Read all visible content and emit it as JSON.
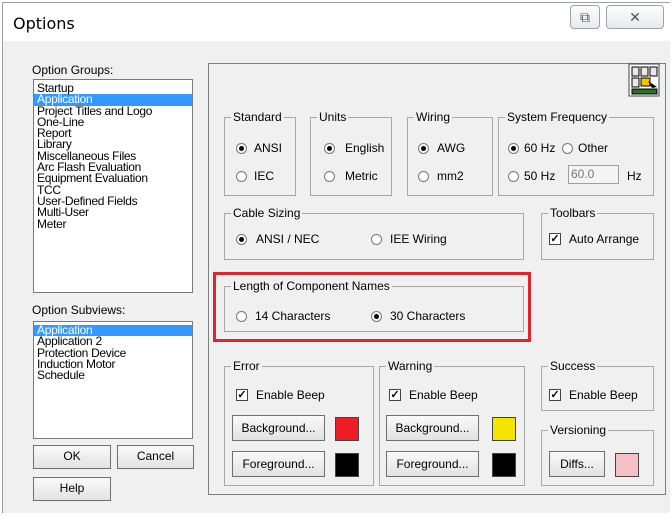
{
  "window": {
    "title": "Options",
    "minimize_glyph": "⧉",
    "close_glyph": "✕"
  },
  "option_groups": {
    "label": "Option Groups:",
    "items": [
      "Startup",
      "Application",
      "Project Titles and Logo",
      "One-Line",
      "Report",
      "Library",
      "Miscellaneous Files",
      "Arc Flash Evaluation",
      "Equipment Evaluation",
      "TCC",
      "User-Defined Fields",
      "Multi-User",
      "Meter"
    ],
    "selected": "Application"
  },
  "option_subviews": {
    "label": "Option Subviews:",
    "items": [
      "Application",
      "Application 2",
      "Protection Device",
      "Induction Motor",
      "Schedule"
    ],
    "selected": "Application"
  },
  "buttons": {
    "ok": "OK",
    "cancel": "Cancel",
    "help": "Help"
  },
  "standard": {
    "title": "Standard",
    "ansi": "ANSI",
    "iec": "IEC",
    "selected": "ANSI"
  },
  "units": {
    "title": "Units",
    "english": "English",
    "metric": "Metric",
    "selected": "English"
  },
  "wiring": {
    "title": "Wiring",
    "awg": "AWG",
    "mm2": "mm2",
    "selected": "AWG"
  },
  "system_frequency": {
    "title": "System Frequency",
    "hz60": "60 Hz",
    "other": "Other",
    "hz50": "50 Hz",
    "other_value": "60.0",
    "unit": "Hz",
    "selected": "60 Hz"
  },
  "cable_sizing": {
    "title": "Cable Sizing",
    "ansi_nec": "ANSI / NEC",
    "iee": "IEE Wiring",
    "selected": "ANSI / NEC"
  },
  "toolbars": {
    "title": "Toolbars",
    "auto_arrange": "Auto Arrange",
    "checked": true
  },
  "component_names": {
    "title": "Length of Component Names",
    "c14": "14 Characters",
    "c30": "30 Characters",
    "selected": "30 Characters",
    "highlight_color": "#e0252c"
  },
  "error": {
    "title": "Error",
    "enable_beep": "Enable Beep",
    "checked": true,
    "background": "Background...",
    "foreground": "Foreground...",
    "bg_color": "#ee1c24",
    "fg_color": "#000000"
  },
  "warning": {
    "title": "Warning",
    "enable_beep": "Enable Beep",
    "checked": true,
    "background": "Background...",
    "foreground": "Foreground...",
    "bg_color": "#f5e400",
    "fg_color": "#000000"
  },
  "success": {
    "title": "Success",
    "enable_beep": "Enable Beep",
    "checked": true
  },
  "versioning": {
    "title": "Versioning",
    "diffs": "Diffs...",
    "color": "#f5c0c4"
  }
}
